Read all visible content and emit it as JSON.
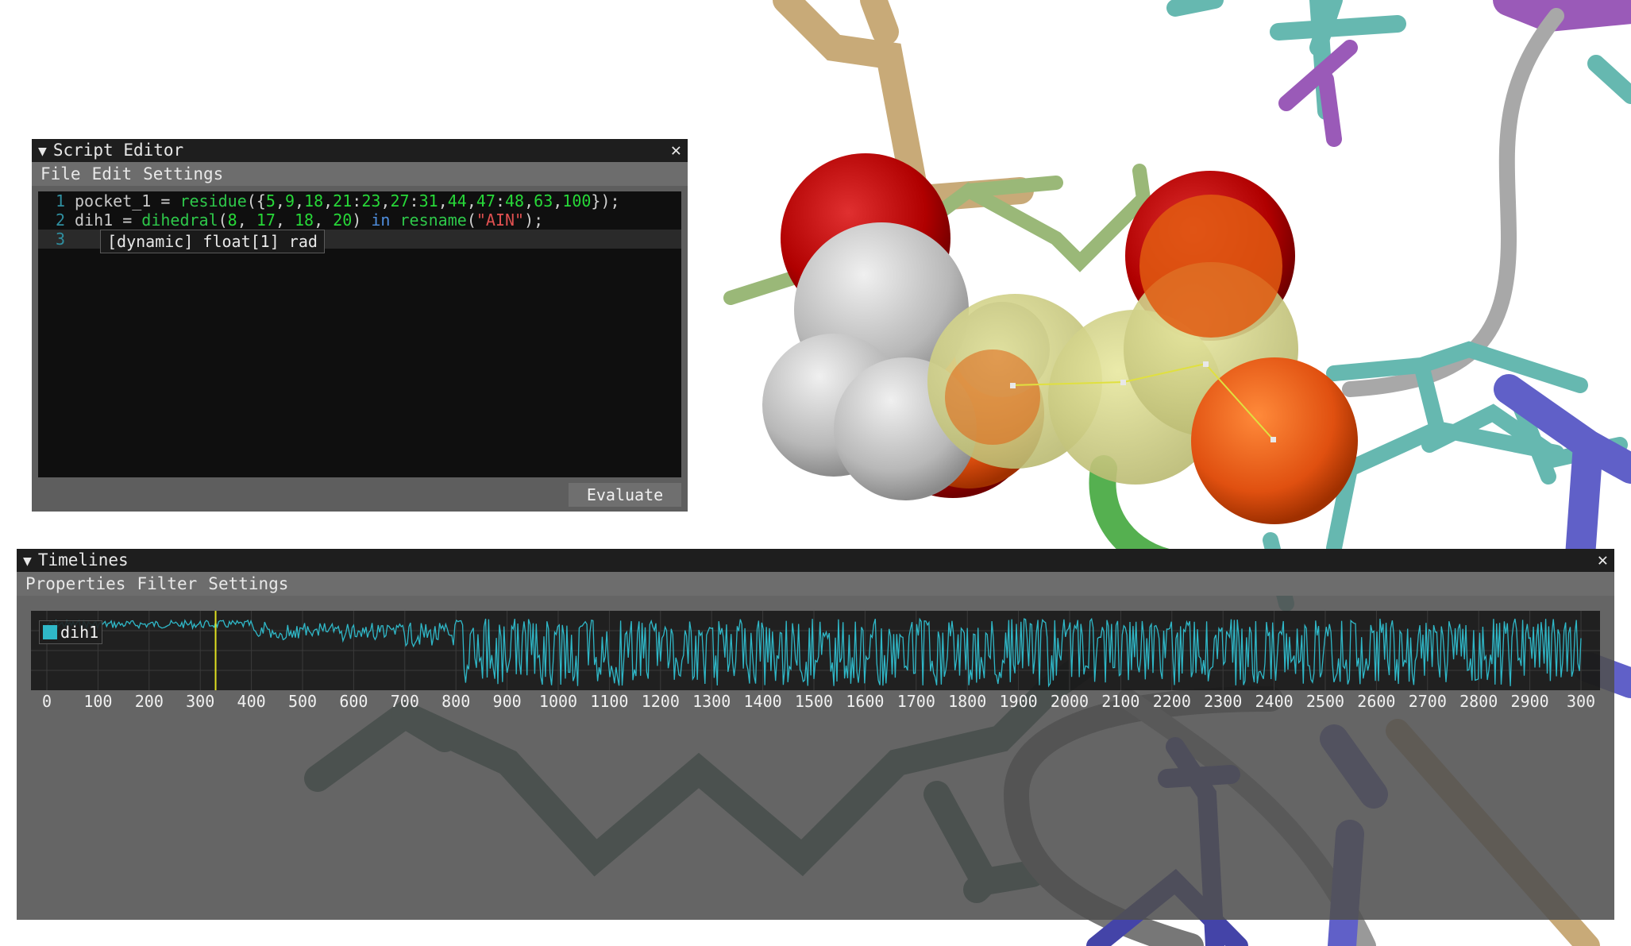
{
  "script_editor": {
    "title": "Script Editor",
    "menu": [
      "File",
      "Edit",
      "Settings"
    ],
    "lines": [
      {
        "num": "1",
        "tokens": [
          {
            "t": "pocket_1",
            "c": "t-id"
          },
          {
            "t": " = ",
            "c": "t-op"
          },
          {
            "t": "residue",
            "c": "t-fn"
          },
          {
            "t": "({",
            "c": "t-op"
          },
          {
            "t": "5",
            "c": "t-num"
          },
          {
            "t": ",",
            "c": "t-op"
          },
          {
            "t": "9",
            "c": "t-num"
          },
          {
            "t": ",",
            "c": "t-op"
          },
          {
            "t": "18",
            "c": "t-num"
          },
          {
            "t": ",",
            "c": "t-op"
          },
          {
            "t": "21",
            "c": "t-num"
          },
          {
            "t": ":",
            "c": "t-op"
          },
          {
            "t": "23",
            "c": "t-num"
          },
          {
            "t": ",",
            "c": "t-op"
          },
          {
            "t": "27",
            "c": "t-num"
          },
          {
            "t": ":",
            "c": "t-op"
          },
          {
            "t": "31",
            "c": "t-num"
          },
          {
            "t": ",",
            "c": "t-op"
          },
          {
            "t": "44",
            "c": "t-num"
          },
          {
            "t": ",",
            "c": "t-op"
          },
          {
            "t": "47",
            "c": "t-num"
          },
          {
            "t": ":",
            "c": "t-op"
          },
          {
            "t": "48",
            "c": "t-num"
          },
          {
            "t": ",",
            "c": "t-op"
          },
          {
            "t": "63",
            "c": "t-num"
          },
          {
            "t": ",",
            "c": "t-op"
          },
          {
            "t": "100",
            "c": "t-num"
          },
          {
            "t": "});",
            "c": "t-op"
          }
        ]
      },
      {
        "num": "2",
        "tokens": [
          {
            "t": "dih1",
            "c": "t-id"
          },
          {
            "t": " = ",
            "c": "t-op"
          },
          {
            "t": "dihedral",
            "c": "t-fn"
          },
          {
            "t": "(",
            "c": "t-op"
          },
          {
            "t": "8",
            "c": "t-num"
          },
          {
            "t": ", ",
            "c": "t-op"
          },
          {
            "t": "17",
            "c": "t-num"
          },
          {
            "t": ", ",
            "c": "t-op"
          },
          {
            "t": "18",
            "c": "t-num"
          },
          {
            "t": ", ",
            "c": "t-op"
          },
          {
            "t": "20",
            "c": "t-num"
          },
          {
            "t": ") ",
            "c": "t-op"
          },
          {
            "t": "in",
            "c": "t-kw"
          },
          {
            "t": " ",
            "c": "t-op"
          },
          {
            "t": "resname",
            "c": "t-fn"
          },
          {
            "t": "(",
            "c": "t-op"
          },
          {
            "t": "\"AIN\"",
            "c": "t-str"
          },
          {
            "t": ");",
            "c": "t-op"
          }
        ]
      },
      {
        "num": "3",
        "tokens": []
      }
    ],
    "tooltip": "[dynamic] float[1] rad",
    "evaluate_label": "Evaluate"
  },
  "timelines": {
    "title": "Timelines",
    "menu": [
      "Properties",
      "Filter",
      "Settings"
    ],
    "legend_label": "dih1",
    "series_color": "#2fb8c8",
    "cursor_color": "#e0e020",
    "cursor_frame": 330,
    "x_ticks": [
      "0",
      "100",
      "200",
      "300",
      "400",
      "500",
      "600",
      "700",
      "800",
      "900",
      "1000",
      "1100",
      "1200",
      "1300",
      "1400",
      "1500",
      "1600",
      "1700",
      "1800",
      "1900",
      "2000",
      "2100",
      "2200",
      "2300",
      "2400",
      "2500",
      "2600",
      "2700",
      "2800",
      "2900",
      "300"
    ]
  }
}
